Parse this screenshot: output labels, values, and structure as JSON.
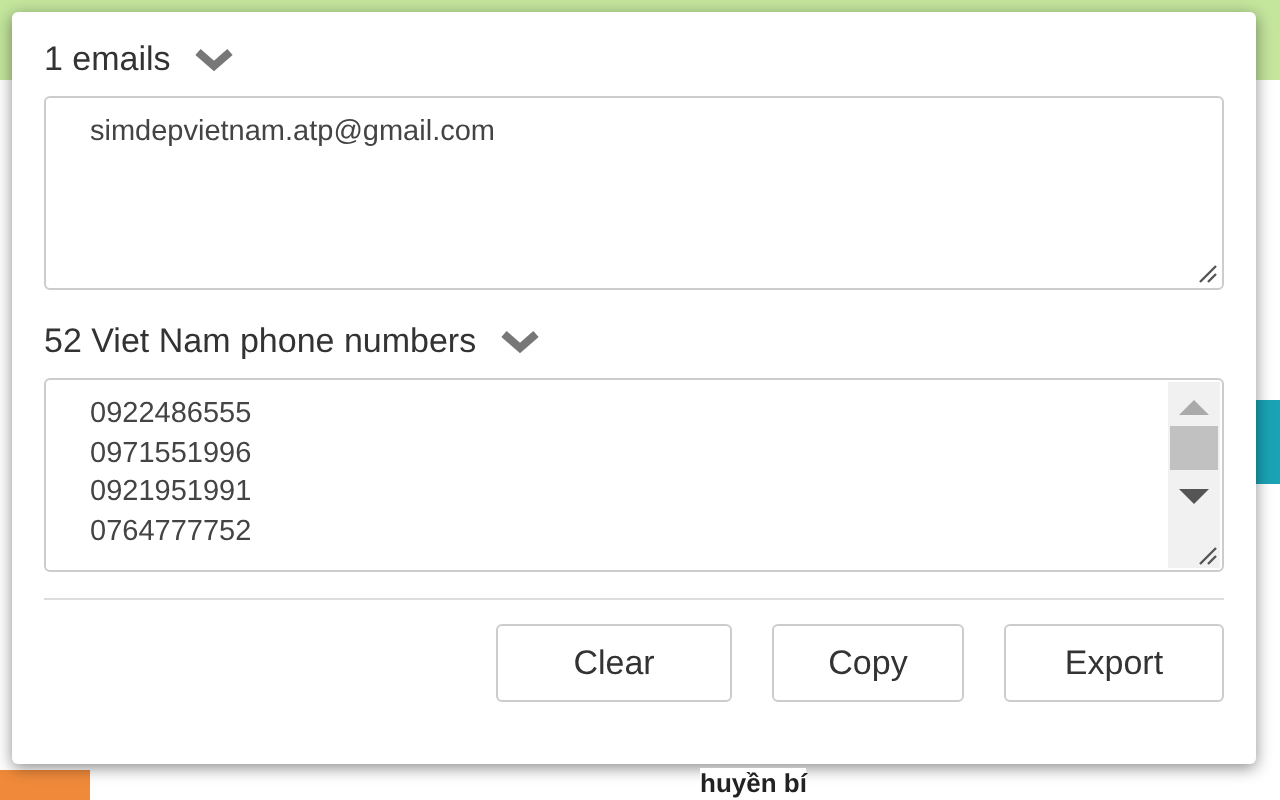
{
  "background": {
    "caption": "huyền bí"
  },
  "emails": {
    "heading": "1 emails",
    "expanded": true,
    "values": [
      "simdepvietnam.atp@gmail.com"
    ]
  },
  "phones": {
    "heading": "52 Viet Nam phone numbers",
    "expanded": true,
    "values": [
      "0922486555",
      "0971551996",
      "0921951991",
      "0764777752"
    ]
  },
  "buttons": [
    {
      "label": "Clear"
    },
    {
      "label": "Copy"
    },
    {
      "label": "Export"
    }
  ]
}
